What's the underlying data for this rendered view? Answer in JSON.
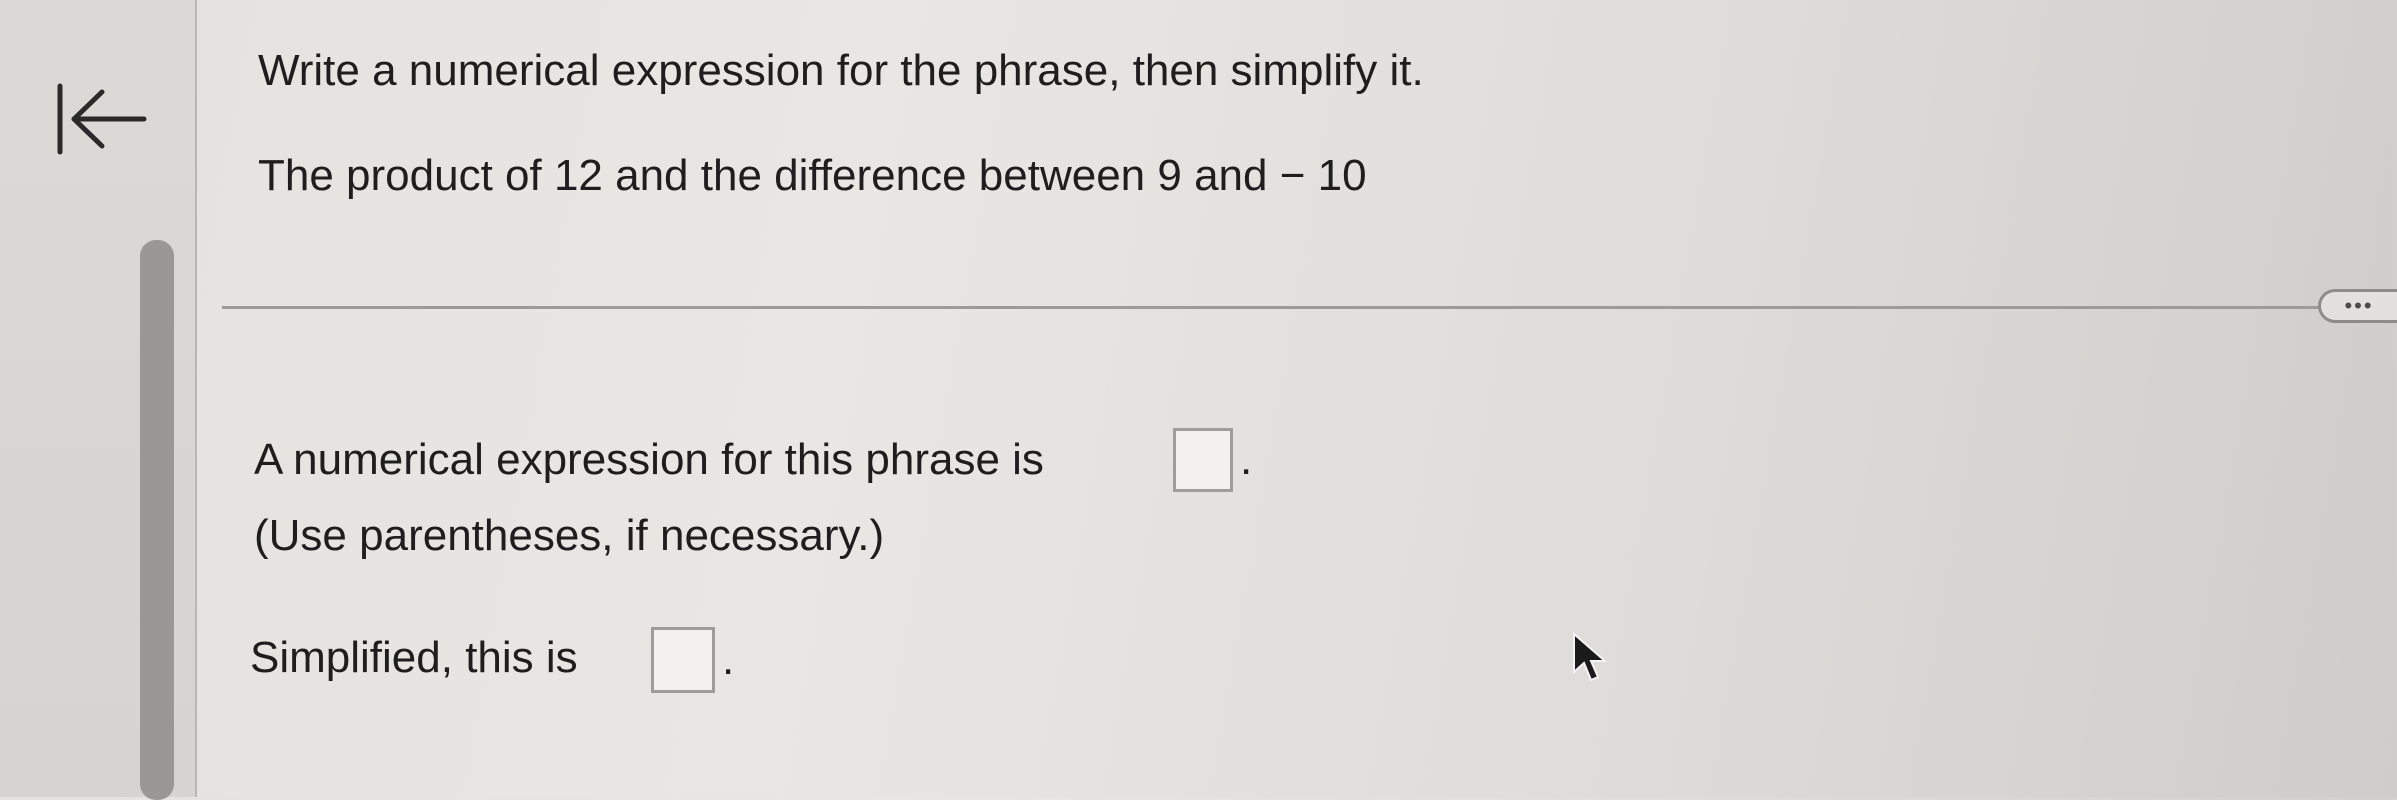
{
  "navigation": {
    "back_icon": "collapse-left-arrow-icon"
  },
  "question": {
    "instruction": "Write a numerical expression for the phrase, then simplify it.",
    "phrase": "The product of 12 and the difference between 9 and  − 10"
  },
  "more_button": {
    "label": "•••"
  },
  "answers": {
    "expression_prompt": "A numerical expression for this phrase is",
    "expression_hint": "(Use parentheses, if necessary.)",
    "simplified_prompt": "Simplified, this is",
    "expression_value": "",
    "simplified_value": "",
    "period": "."
  },
  "colors": {
    "background": "#e6e4e1",
    "text": "#1e1e1e",
    "divider": "#9d9b99",
    "scrollbar": "#9a9896"
  }
}
